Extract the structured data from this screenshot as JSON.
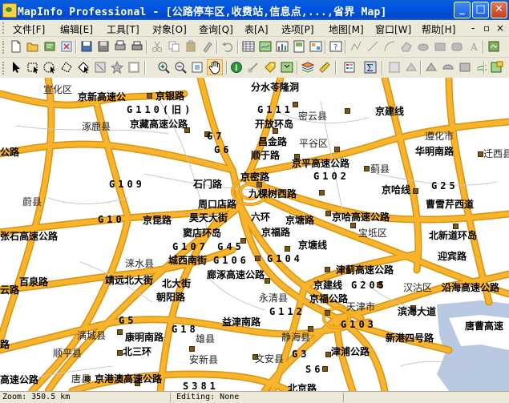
{
  "window": {
    "title": "MapInfo Professional - [公路停车区,收费站,信息点,...,省界 Map]",
    "minimize_glyph": "_",
    "maximize_glyph": "□",
    "close_glyph": "✕"
  },
  "menubar": {
    "items": [
      "文件[F]",
      "编辑[E]",
      "工具[T]",
      "对象[O]",
      "查询[Q]",
      "表[A]",
      "选项[P]",
      "地图[M]",
      "窗口[W]",
      "帮助[H]"
    ],
    "mdi_min": "-",
    "mdi_restore": "▫",
    "mdi_close": "×"
  },
  "toolbar1": {
    "icons": [
      "new-icon",
      "open-icon",
      "open-workspace-icon",
      "close-icon",
      "save-icon",
      "save-copy-icon",
      "print-icon",
      "cut-icon",
      "copy-icon",
      "paste-icon",
      "undo-icon",
      "browser-icon",
      "map-window-icon",
      "graph-icon",
      "layout-icon",
      "redistrict-icon",
      "help-icon",
      "line-icon",
      "polyline-icon",
      "arc-icon",
      "polygon-icon",
      "ellipse-icon",
      "rectangle-icon",
      "rounded-rect-icon",
      "text-icon",
      "frame-icon",
      "symbol-icon"
    ]
  },
  "toolbar2": {
    "icons": [
      "select-icon",
      "marquee-select-icon",
      "radius-select-icon",
      "boundary-select-icon",
      "polygon-select-icon",
      "unselect-icon",
      "invert-select-icon",
      "zoom-in-icon",
      "zoom-out-icon",
      "hand-icon",
      "info-icon",
      "ruler-icon",
      "label-icon",
      "drag-map-icon",
      "layer-control-icon",
      "ruler2-icon",
      "legend-icon",
      "statistics-icon",
      "clip-icon",
      "set-target-icon",
      "combine-icon",
      "erase-icon",
      "split-icon",
      "hotlink-icon"
    ]
  },
  "map": {
    "colors": {
      "road": "#f7b02a",
      "road_edge": "#c98a12",
      "water": "#b8c8e0"
    },
    "labels": {
      "l1": "分水苓隆洞",
      "l2": "宣化区",
      "l3": "京新高速公",
      "l4": "京银路",
      "l5": "G110(旧)",
      "l6": "G111",
      "l7": "密云县",
      "l8": "京建线",
      "l9": "涿鹿县",
      "l10": "京藏高速公路",
      "l11": "开放环岛",
      "l12": "遵化市",
      "l13": "G7",
      "l14": "昌金路",
      "l15": "平谷区",
      "l16": "公路",
      "l17": "G6",
      "l18": "顺于路",
      "l19": "华明南路",
      "l20": "迁西县",
      "l21": "京平高速公路",
      "l22": "G102",
      "l23": "蓟县",
      "l24": "G109",
      "l25": "石门路",
      "l26": "京密路",
      "l27": "京哈线",
      "l28": "G25",
      "l29": "蔚县",
      "l30": "周口店路",
      "l31": "九棵树西路",
      "l32": "曹雪芹西道",
      "l33": "G10",
      "l34": "京昆路",
      "l35": "昊天大街",
      "l36": "六环",
      "l37": "京塘路",
      "l38": "京哈高速公路",
      "l39": "张石高速公路",
      "l40": "窦店环岛",
      "l41": "京福路",
      "l42": "宝坻区",
      "l43": "北新道环岛",
      "l44": "G107 G45",
      "l45": "京塘线",
      "l46": "迎宾路",
      "l47": "涞水县",
      "l48": "城西南街",
      "l49": "G106",
      "l50": "G104",
      "l51": "津蓟高速公路",
      "l52": "百泉路",
      "l53": "靖远北大街",
      "l54": "北大街",
      "l55": "廊涿高速公路",
      "l56": "京建线",
      "l57": "G205",
      "l58": "汉沽区",
      "l59": "沿海高速公路",
      "l60": "云路",
      "l61": "朝阳路",
      "l62": "永清县",
      "l63": "京福公路",
      "l64": "天津市",
      "l65": "G112",
      "l66": "滨海大道",
      "l67": "G5",
      "l68": "益津南路",
      "l69": "G103",
      "l70": "唐曹高速",
      "l71": "满城县",
      "l72": "康明南路",
      "l73": "G18",
      "l74": "静海县",
      "l75": "新港四号路",
      "l76": "北三环",
      "l77": "雄县",
      "l78": "顺平县",
      "l79": "安新县",
      "l80": "文安县",
      "l81": "G3",
      "l82": "津浦公路",
      "l83": "S6",
      "l84": "唐县",
      "l85": "京港澳高速公路",
      "l86": "S381",
      "l87": "北京路",
      "l88": "路",
      "l89": "高速公路"
    }
  },
  "statusbar": {
    "zoom": "Zoom: 350.5 km",
    "editing": "Editing: None"
  }
}
